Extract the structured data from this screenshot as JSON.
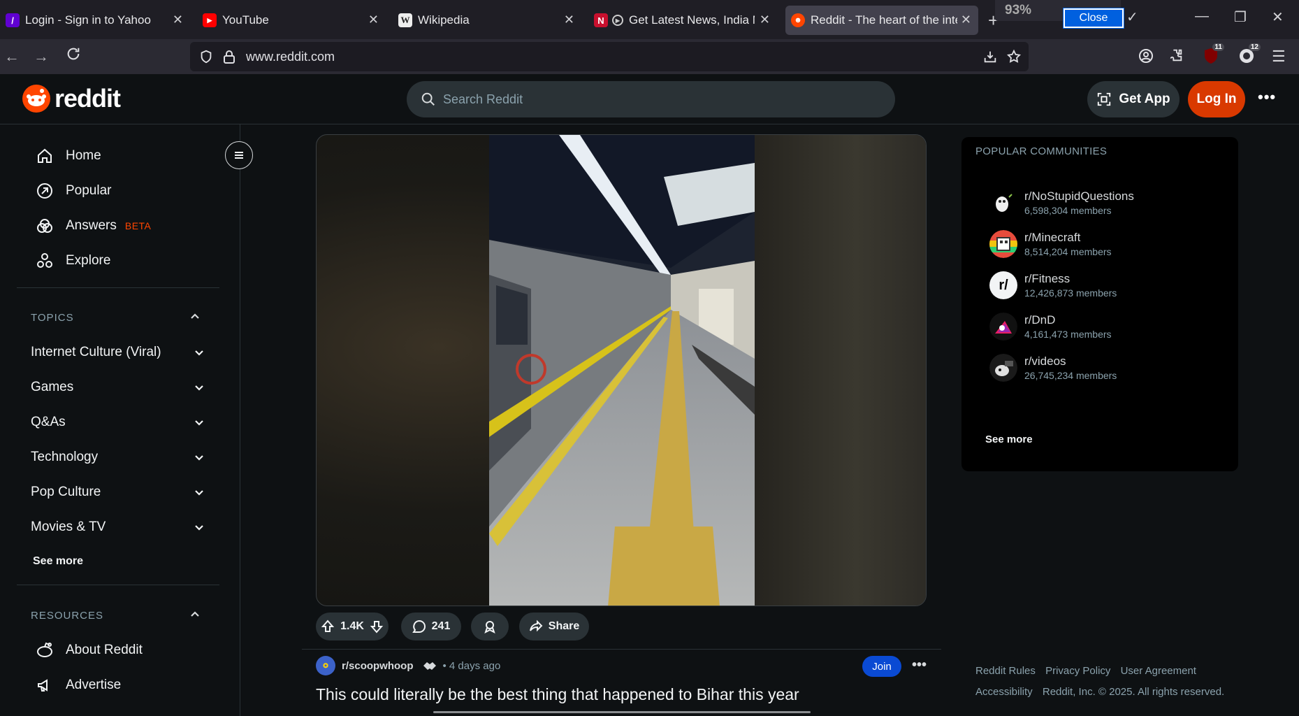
{
  "browser": {
    "tabs": [
      {
        "title": "Login - Sign in to Yahoo",
        "icon": "yahoo-icon"
      },
      {
        "title": "YouTube",
        "icon": "youtube-icon"
      },
      {
        "title": "Wikipedia",
        "icon": "wikipedia-icon"
      },
      {
        "title": "Get Latest News, India New",
        "icon": "news-icon"
      },
      {
        "title": "Reddit - The heart of the interne",
        "icon": "reddit-icon"
      }
    ],
    "zoom_level": "93%",
    "close_label": "Close",
    "url": "www.reddit.com",
    "badges": {
      "ublock": "11",
      "profile": "12"
    }
  },
  "header": {
    "logo_text": "reddit",
    "search_placeholder": "Search Reddit",
    "get_app": "Get App",
    "login": "Log In"
  },
  "sidebar": {
    "nav": [
      {
        "label": "Home"
      },
      {
        "label": "Popular"
      },
      {
        "label": "Answers",
        "badge": "BETA"
      },
      {
        "label": "Explore"
      }
    ],
    "topics_heading": "TOPICS",
    "topics": [
      "Internet Culture (Viral)",
      "Games",
      "Q&As",
      "Technology",
      "Pop Culture",
      "Movies & TV"
    ],
    "see_more": "See more",
    "resources_heading": "RESOURCES",
    "resources": [
      "About Reddit",
      "Advertise"
    ]
  },
  "post": {
    "upvotes": "1.4K",
    "comments": "241",
    "share": "Share",
    "subreddit": "r/scoopwhoop",
    "time": "• 4 days ago",
    "join": "Join",
    "title": "This could literally be the best thing that happened to Bihar this year"
  },
  "rail": {
    "heading": "POPULAR COMMUNITIES",
    "communities": [
      {
        "name": "r/NoStupidQuestions",
        "members": "6,598,304 members"
      },
      {
        "name": "r/Minecraft",
        "members": "8,514,204 members"
      },
      {
        "name": "r/Fitness",
        "members": "12,426,873 members"
      },
      {
        "name": "r/DnD",
        "members": "4,161,473 members"
      },
      {
        "name": "r/videos",
        "members": "26,745,234 members"
      }
    ],
    "see_more": "See more"
  },
  "footer": {
    "links": [
      "Reddit Rules",
      "Privacy Policy",
      "User Agreement",
      "Accessibility"
    ],
    "copyright": "Reddit, Inc. © 2025. All rights reserved."
  },
  "colors": {
    "brand": "#ff4500",
    "login": "#d93900",
    "join": "#0a4ad3",
    "background": "#0e1113"
  }
}
